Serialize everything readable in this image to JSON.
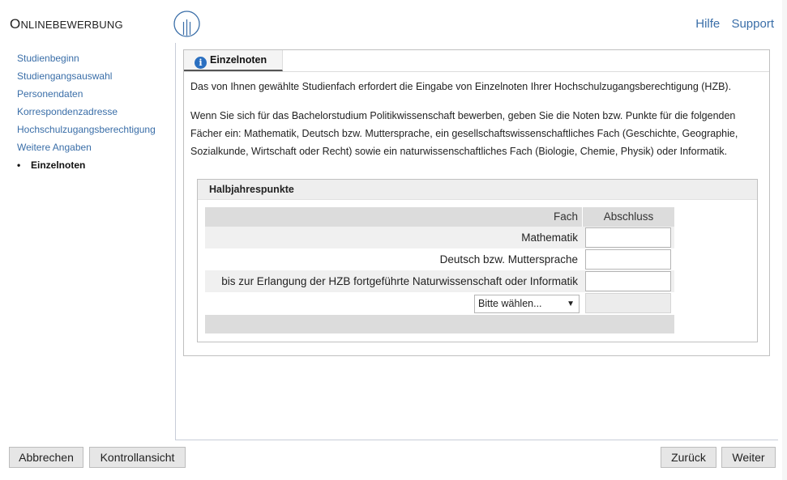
{
  "header": {
    "app_title_first": "O",
    "app_title_rest": "nlinebewerbung",
    "links": {
      "help": "Hilfe",
      "support": "Support"
    }
  },
  "sidebar": {
    "items": [
      {
        "label": "Studienbeginn"
      },
      {
        "label": "Studiengangsauswahl"
      },
      {
        "label": "Personendaten"
      },
      {
        "label": "Korrespondenzadresse"
      },
      {
        "label": "Hochschulzugangsberechtigung"
      },
      {
        "label": "Weitere Angaben"
      },
      {
        "label": "Einzelnoten"
      }
    ]
  },
  "panel": {
    "tab_label": "Einzelnoten",
    "paragraph1": "Das von Ihnen gewählte Studienfach erfordert die Eingabe von Einzelnoten Ihrer Hochschulzugangsberechtigung (HZB).",
    "paragraph2": "Wenn Sie sich für das Bachelorstudium Politikwissenschaft bewerben, geben Sie die Noten bzw. Punkte für die folgenden Fächer ein: Mathematik, Deutsch bzw. Muttersprache, ein gesellschaftswissenschaftliches Fach (Geschichte, Geographie, Sozialkunde, Wirtschaft oder Recht) sowie ein naturwissenschaftliches Fach (Biologie, Chemie, Physik) oder Informatik.",
    "group": {
      "title": "Halbjahrespunkte",
      "columns": {
        "subject": "Fach",
        "grade": "Abschluss"
      },
      "rows": [
        {
          "label": "Mathematik",
          "value": ""
        },
        {
          "label": "Deutsch bzw. Muttersprache",
          "value": ""
        },
        {
          "label": "bis zur Erlangung der HZB fortgeführte Naturwissenschaft oder Informatik",
          "value": ""
        }
      ],
      "select": {
        "selected": "Bitte wählen..."
      }
    }
  },
  "buttons": {
    "cancel": "Abbrechen",
    "review": "Kontrollansicht",
    "back": "Zurück",
    "next": "Weiter"
  },
  "colors": {
    "link": "#3a6ea8",
    "info_icon": "#2a6fc0"
  }
}
